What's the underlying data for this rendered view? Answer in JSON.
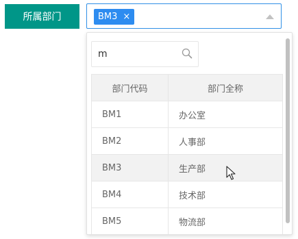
{
  "form": {
    "label": "所属部门",
    "select": {
      "tags": [
        {
          "label": "BM3",
          "close": "×"
        }
      ],
      "caret_icon": "caret-up-icon"
    }
  },
  "dropdown": {
    "search": {
      "value": "m",
      "placeholder": "",
      "icon": "search-icon"
    },
    "table": {
      "headers": [
        "部门代码",
        "部门全称"
      ],
      "rows": [
        {
          "code": "BM1",
          "name": "办公室"
        },
        {
          "code": "BM2",
          "name": "人事部"
        },
        {
          "code": "BM3",
          "name": "生产部"
        },
        {
          "code": "BM4",
          "name": "技术部"
        },
        {
          "code": "BM5",
          "name": "物流部"
        }
      ],
      "hovered_row_index": 2
    }
  },
  "colors": {
    "label_bg": "#009688",
    "tag_bg": "#2d8cf0",
    "select_border": "#2f8fe6",
    "header_bg": "#f2f2f2",
    "hover_bg": "#f2f2f2",
    "grid_border": "#e6e6e6"
  }
}
